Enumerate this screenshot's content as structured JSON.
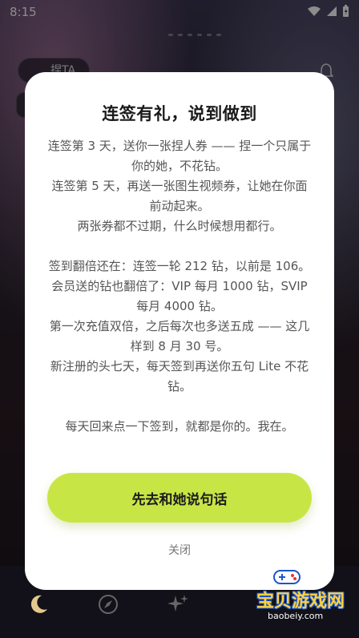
{
  "status_bar": {
    "time": "8:15"
  },
  "background": {
    "chip_label": "捏TA"
  },
  "modal": {
    "title": "连签有礼，说到做到",
    "paragraphs": [
      "连签第 3 天，送你一张捏人券 —— 捏一个只属于你的她，不花钻。",
      "连签第 5 天，再送一张图生视频券，让她在你面前动起来。",
      "两张券都不过期，什么时候想用都行。",
      "",
      "签到翻倍还在：连签一轮 212 钻，以前是 106。",
      "会员送的钻也翻倍了：VIP 每月 1000 钻，SVIP 每月 4000 钻。",
      "第一次充值双倍，之后每次也多送五成 —— 这几样到 8 月 30 号。",
      "新注册的头七天，每天签到再送你五句 Lite 不花钻。",
      "",
      "每天回来点一下签到，就都是你的。我在。"
    ],
    "cta_label": "先去和她说句话",
    "close_label": "关闭"
  },
  "watermark": {
    "text": "宝贝游戏网",
    "url": "baobeiy.com"
  },
  "colors": {
    "cta": "#c7e646",
    "modal_bg": "#ffffff"
  }
}
